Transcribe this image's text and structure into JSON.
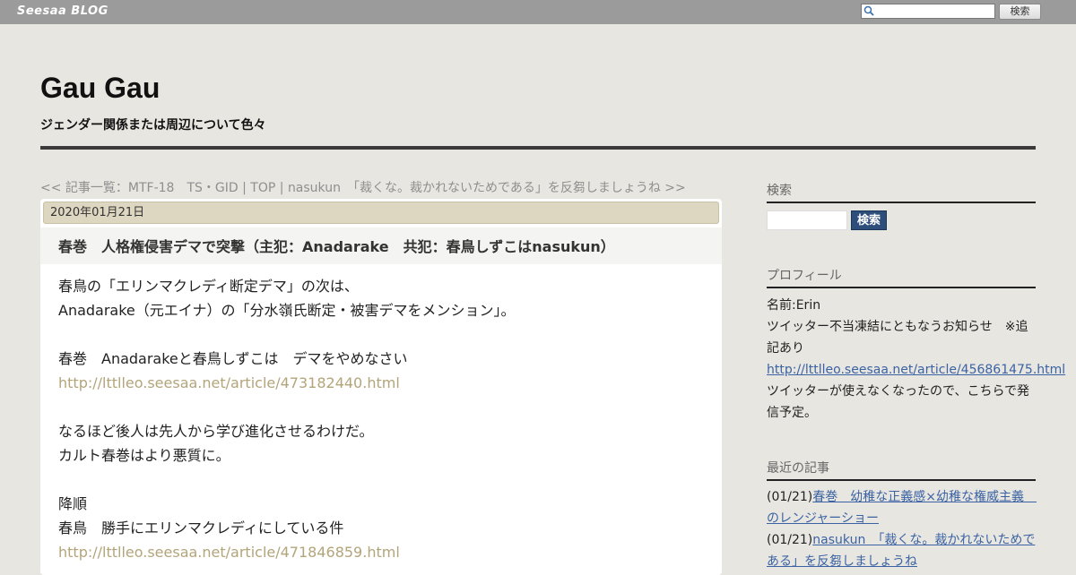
{
  "topbar": {
    "logo_text": "Seesaa BLOG",
    "search_button": "検索",
    "search_icon": "magnifier-icon"
  },
  "header": {
    "title": "Gau Gau",
    "description": "ジェンダー関係または周辺について色々"
  },
  "nav": {
    "prev": "<< 記事一覧：MTF-18　TS・GID",
    "sep1": " | ",
    "top": "TOP",
    "sep2": " | ",
    "next": "nasukun　「裁くな。裁かれないためである」を反芻しましょうね >>"
  },
  "article": {
    "date": "2020年01月21日",
    "title": "春巻　人格権侵害デマで突撃（主犯：Anadarake　共犯：春鳥しずこはnasukun）",
    "lines": [
      {
        "text": "春鳥の「エリンマクレディ断定デマ」の次は、",
        "link": false
      },
      {
        "text": "Anadarake（元エイナ）の「分水嶺氏断定・被害デマをメンション」。",
        "link": false
      },
      {
        "text": "",
        "link": false
      },
      {
        "text": "春巻　Anadarakeと春鳥しずこは　デマをやめなさい",
        "link": false
      },
      {
        "text": "http://lttlleo.seesaa.net/article/473182440.html",
        "link": true
      },
      {
        "text": "",
        "link": false
      },
      {
        "text": "なるほど後人は先人から学び進化させるわけだ。",
        "link": false
      },
      {
        "text": "カルト春巻はより悪質に。",
        "link": false
      },
      {
        "text": "",
        "link": false
      },
      {
        "text": "降順",
        "link": false
      },
      {
        "text": "春鳥　勝手にエリンマクレディにしている件",
        "link": false
      },
      {
        "text": "http://lttlleo.seesaa.net/article/471846859.html",
        "link": true
      }
    ]
  },
  "sidebar": {
    "search_heading": "検索",
    "search_button": "検索",
    "profile_heading": "プロフィール",
    "profile_name": "名前:Erin",
    "profile_line1": "ツイッター不当凍結にともなうお知らせ　※追",
    "profile_line2": "記あり",
    "profile_link": "http://lttlleo.seesaa.net/article/456861475.html",
    "profile_line3": "ツイッターが使えなくなったので、こちらで発",
    "profile_line4": "信予定。",
    "recent_heading": "最近の記事",
    "recent": [
      {
        "date": "(01/21)",
        "title_a": "春巻　幼稚な正義感×幼稚な権威主義　",
        "title_b": "のレンジャーショー"
      },
      {
        "date": "(01/21)",
        "title_a": "nasukun　「裁くな。裁かれないためで",
        "title_b": "ある」を反芻しましょうね"
      }
    ]
  },
  "colors": {
    "page_bg": "#e8e6e1",
    "topbar_bg": "#9b9b9b",
    "date_bar_bg": "#ddd6c0",
    "article_link": "#b3a47a",
    "sidebar_link": "#3b63a3",
    "sidebar_button_bg": "#2d4e7a"
  }
}
